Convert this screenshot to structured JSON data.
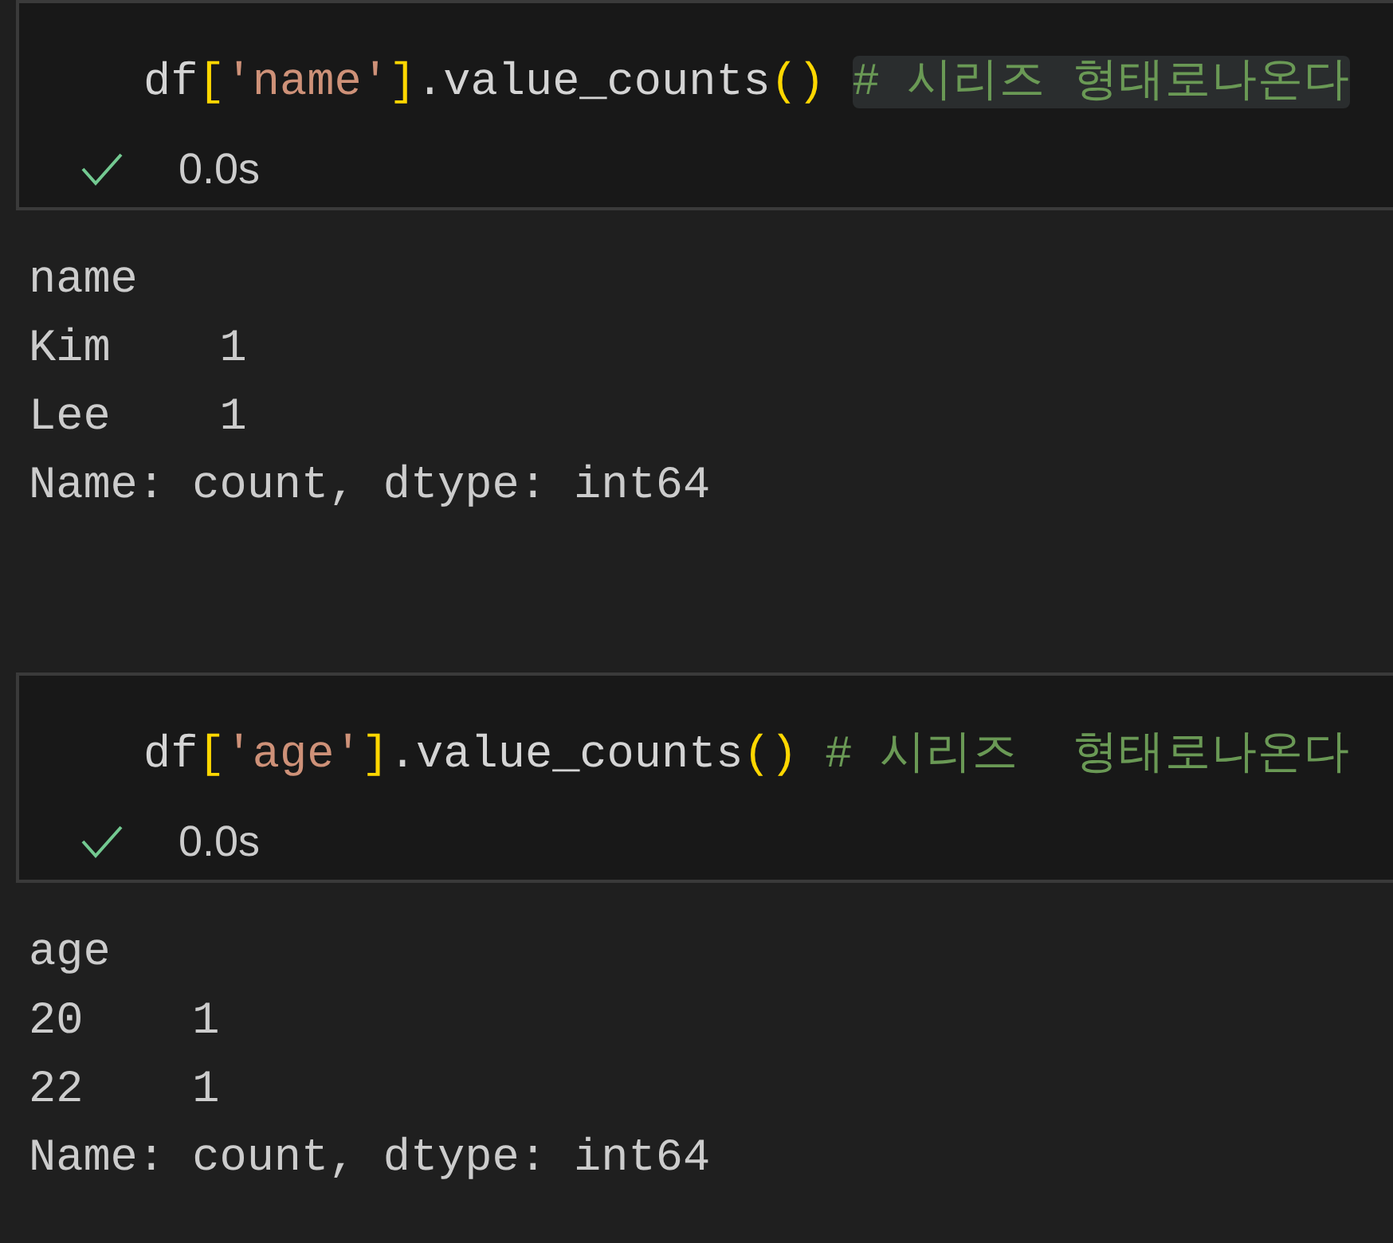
{
  "cells": [
    {
      "code": [
        {
          "kind": "plain",
          "text": "df"
        },
        {
          "kind": "bracket",
          "text": "["
        },
        {
          "kind": "string",
          "text": "'name'"
        },
        {
          "kind": "bracket",
          "text": "]"
        },
        {
          "kind": "plain",
          "text": ".value_counts"
        },
        {
          "kind": "bracket",
          "text": "()"
        },
        {
          "kind": "comment",
          "text": "# 시리즈 형태로나온다",
          "highlighted": true
        }
      ],
      "status": {
        "success": true,
        "time": "0.0s"
      },
      "output": [
        "name",
        "Kim    1",
        "Lee    1",
        "Name: count, dtype: int64"
      ]
    },
    {
      "code": [
        {
          "kind": "plain",
          "text": "df"
        },
        {
          "kind": "bracket",
          "text": "["
        },
        {
          "kind": "string",
          "text": "'age'"
        },
        {
          "kind": "bracket",
          "text": "]"
        },
        {
          "kind": "plain",
          "text": ".value_counts"
        },
        {
          "kind": "bracket",
          "text": "()"
        },
        {
          "kind": "comment",
          "text": "# 시리즈  형태로나온다",
          "highlighted": false
        }
      ],
      "status": {
        "success": true,
        "time": "0.0s"
      },
      "output": [
        "age",
        "20    1",
        "22    1",
        "Name: count, dtype: int64"
      ]
    }
  ]
}
